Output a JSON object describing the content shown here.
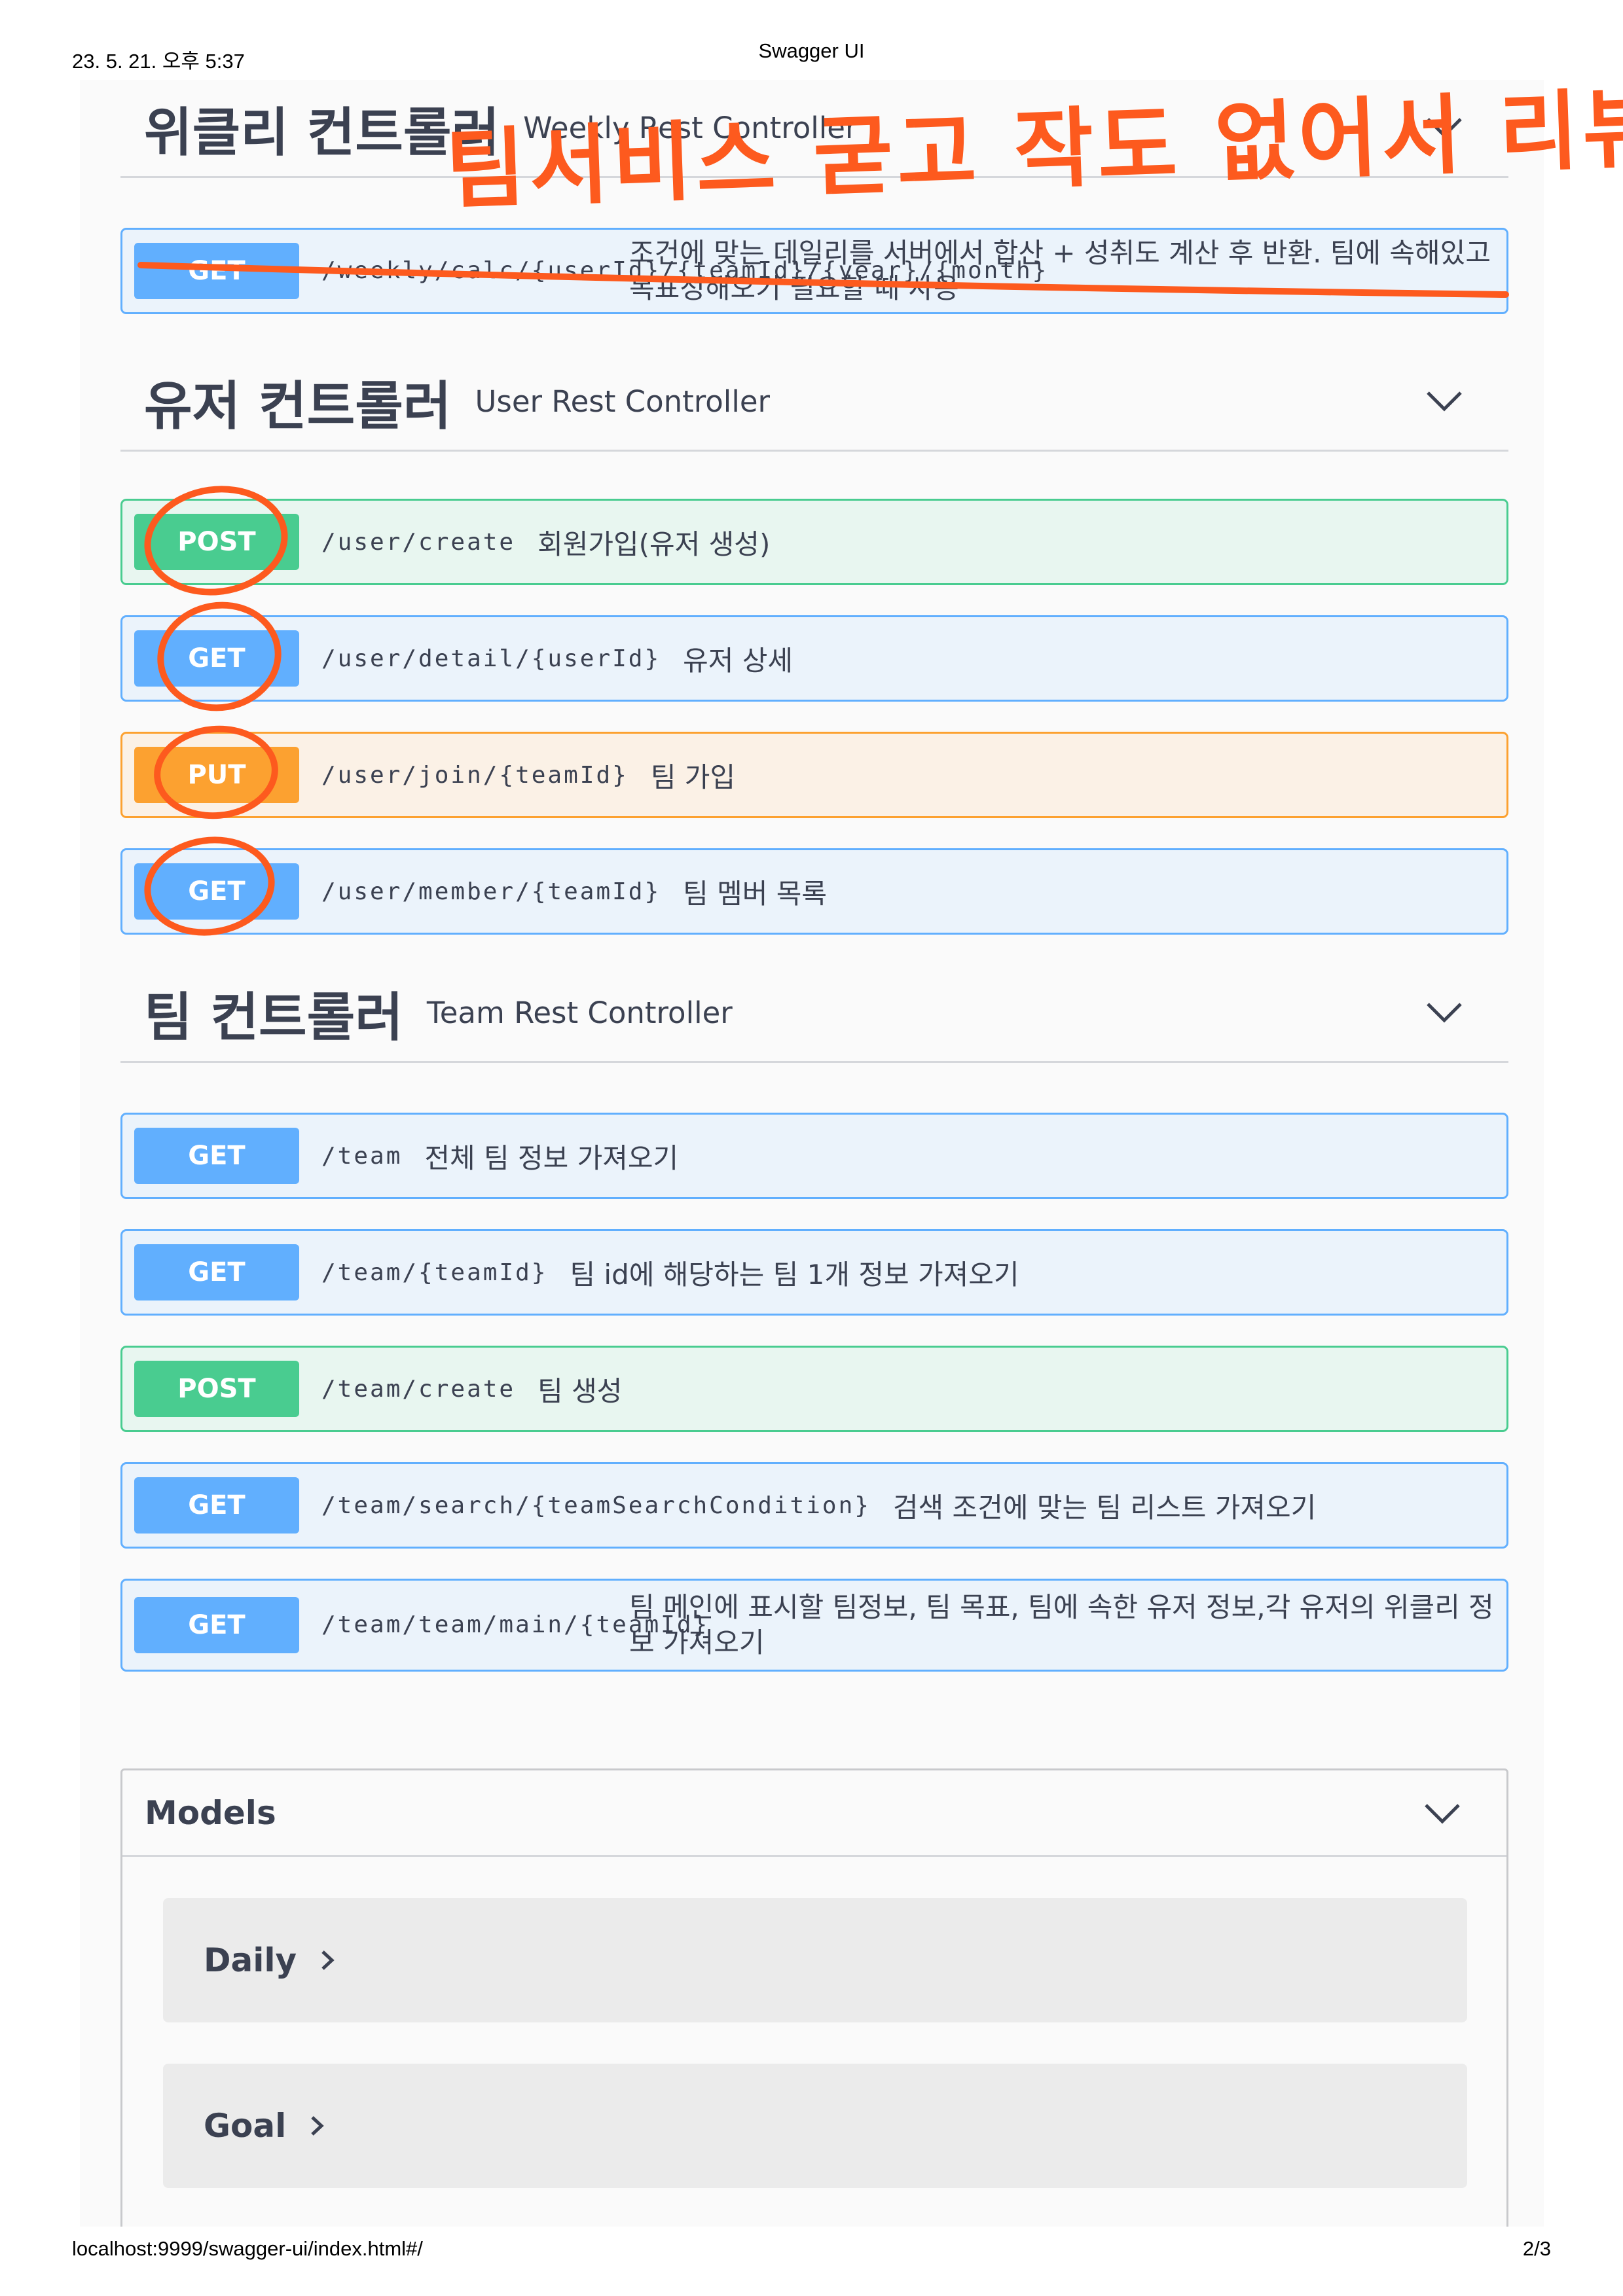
{
  "print_header": {
    "date": "23. 5. 21. 오후 5:37",
    "title": "Swagger UI"
  },
  "print_footer": {
    "url": "localhost:9999/swagger-ui/index.html#/",
    "page": "2/3"
  },
  "sections": [
    {
      "title_ko": "위클리 컨트롤러",
      "title_en": "Weekly Rest Controller",
      "operations": [
        {
          "method": "GET",
          "path": "/weekly/calc/{userId}/{teamId}/{year}/{month}",
          "description": "조건에 맞는 데일리를 서버에서 합산 + 성취도 계산 후 반환. 팀에 속해있고 목표정해오기 필요할 때 사용"
        }
      ]
    },
    {
      "title_ko": "유저 컨트롤러",
      "title_en": "User Rest Controller",
      "operations": [
        {
          "method": "POST",
          "path": "/user/create",
          "description": "회원가입(유저 생성)"
        },
        {
          "method": "GET",
          "path": "/user/detail/{userId}",
          "description": "유저 상세"
        },
        {
          "method": "PUT",
          "path": "/user/join/{teamId}",
          "description": "팀 가입"
        },
        {
          "method": "GET",
          "path": "/user/member/{teamId}",
          "description": "팀 멤버 목록"
        }
      ]
    },
    {
      "title_ko": "팀 컨트롤러",
      "title_en": "Team Rest Controller",
      "operations": [
        {
          "method": "GET",
          "path": "/team",
          "description": "전체 팀 정보 가져오기"
        },
        {
          "method": "GET",
          "path": "/team/{teamId}",
          "description": "팀 id에 해당하는 팀 1개 정보 가져오기"
        },
        {
          "method": "POST",
          "path": "/team/create",
          "description": "팀 생성"
        },
        {
          "method": "GET",
          "path": "/team/search/{teamSearchCondition}",
          "description": "검색 조건에 맞는 팀 리스트 가져오기"
        },
        {
          "method": "GET",
          "path": "/team/team/main/{teamId}",
          "description": "팀 메인에 표시할 팀정보, 팀 목표, 팀에 속한 유저 정보,각 유저의 위클리 정보 가져오기"
        }
      ]
    }
  ],
  "models": {
    "title": "Models",
    "items": [
      "Daily",
      "Goal"
    ]
  },
  "annotation": {
    "handwritten_note": "팀서비스 굳고 작도 없어서 리뷰?",
    "color": "#fd5a1e"
  },
  "colors": {
    "get": "#61affe",
    "post": "#49cc90",
    "put": "#fca130"
  }
}
